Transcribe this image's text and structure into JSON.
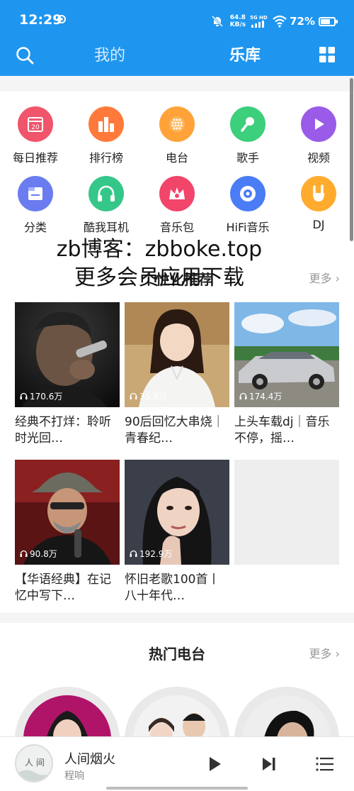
{
  "status_bar": {
    "time": "12:29",
    "speed_value": "64.8",
    "speed_unit": "KB/s",
    "network": "5G HD",
    "battery_pct": "72%",
    "battery_level": 0.72
  },
  "nav": {
    "tab_mine": "我的",
    "tab_library": "乐库",
    "search_icon": "search-icon",
    "grid_icon": "grid-menu-icon"
  },
  "shortcuts": [
    {
      "label": "每日推荐",
      "icon": "calendar-icon",
      "color": "#f0556b",
      "text": "20"
    },
    {
      "label": "排行榜",
      "icon": "bar-chart-icon",
      "color": "#ff7a3a"
    },
    {
      "label": "电台",
      "icon": "radio-icon",
      "color": "#ffa23a"
    },
    {
      "label": "歌手",
      "icon": "microphone-icon",
      "color": "#3ccf7c"
    },
    {
      "label": "视频",
      "icon": "play-icon",
      "color": "#9a5be8"
    },
    {
      "label": "分类",
      "icon": "category-icon",
      "color": "#6a7cf0"
    },
    {
      "label": "酷我耳机",
      "icon": "headphones-icon",
      "color": "#35c78a"
    },
    {
      "label": "音乐包",
      "icon": "crown-icon",
      "color": "#f2456a"
    },
    {
      "label": "HiFi音乐",
      "icon": "disc-icon",
      "color": "#4a7df5"
    },
    {
      "label": "DJ",
      "icon": "rock-hand-icon",
      "color": "#ffac2e"
    }
  ],
  "watermark": {
    "line1": "zb博客：zbboke.top",
    "line2": "更多会员应用下载"
  },
  "recommend": {
    "title": "个性化推荐",
    "more": "更多",
    "cards": [
      {
        "plays": "170.6万",
        "title": "经典不打烊：聆听时光回…"
      },
      {
        "plays": "35.8万",
        "title": "90后回忆大串烧｜青春纪…"
      },
      {
        "plays": "174.4万",
        "title": "上头车载dj｜音乐不停，摇…"
      },
      {
        "plays": "90.8万",
        "title": "【华语经典】在记忆中写下…"
      },
      {
        "plays": "192.9万",
        "title": "怀旧老歌100首丨八十年代…"
      }
    ]
  },
  "hot_radio": {
    "title": "热门电台",
    "more": "更多"
  },
  "player": {
    "song": "人间烟火",
    "artist": "程响"
  },
  "colors": {
    "accent": "#1e96f0"
  }
}
